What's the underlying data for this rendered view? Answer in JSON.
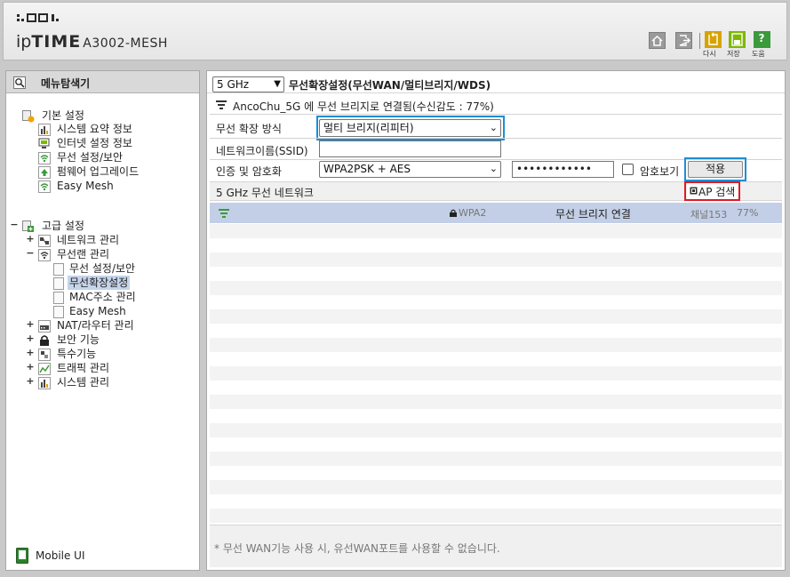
{
  "header": {
    "logo_dots": "▪▫▫▪",
    "brand": "ipTIME",
    "model": "A3002-MESH",
    "icons": [
      "home-icon",
      "logout-icon"
    ],
    "actions": [
      {
        "label": "다시",
        "icon": "refresh-icon",
        "color": "#d6a400"
      },
      {
        "label": "저장",
        "icon": "save-icon",
        "color": "#7fb800"
      },
      {
        "label": "도움",
        "icon": "help-icon",
        "color": "#3b9a3b"
      }
    ]
  },
  "sidebar": {
    "title": "메뉴탐색기",
    "basic": {
      "label": "기본 설정",
      "items": [
        "시스템 요약 정보",
        "인터넷 설정 정보",
        "무선 설정/보안",
        "펌웨어 업그레이드",
        "Easy Mesh"
      ]
    },
    "advanced": {
      "label": "고급 설정",
      "expander": "−",
      "items": [
        {
          "label": "네트워크 관리",
          "expander": "+"
        },
        {
          "label": "무선랜 관리",
          "expander": "−"
        },
        {
          "label": "NAT/라우터 관리",
          "expander": "+"
        },
        {
          "label": "보안 기능",
          "expander": "+"
        },
        {
          "label": "특수기능",
          "expander": "+"
        },
        {
          "label": "트래픽 관리",
          "expander": "+"
        },
        {
          "label": "시스템 관리",
          "expander": "+"
        }
      ],
      "wireless_sub": [
        "무선 설정/보안",
        "무선확장설정",
        "MAC주소 관리",
        "Easy Mesh"
      ],
      "selected": "무선확장설정"
    },
    "footer": "Mobile UI"
  },
  "main": {
    "band_select": "5 GHz",
    "page_title": "무선확장설정(무선WAN/멀티브리지/WDS)",
    "status": "AncoChu_5G 에 무선 브리지로 연결됨(수신감도 : 77%)",
    "form": {
      "mode_label": "무선 확장 방식",
      "mode_value": "멀티 브리지(리피터)",
      "ssid_label": "네트워크이름(SSID)",
      "ssid_value": "",
      "auth_label": "인증 및 암호화",
      "auth_value": "WPA2PSK + AES",
      "password_value": "••••••••••••",
      "show_password_label": "암호보기",
      "apply_button": "적용"
    },
    "network_section_title": "5 GHz 무선 네트워크",
    "ap_scan_button": "AP 검색",
    "ap_list": [
      {
        "security": "WPA2",
        "status": "무선 브리지 연결",
        "channel": "채널153",
        "signal": "77%"
      }
    ],
    "footnote": "* 무선 WAN기능 사용 시, 유선WAN포트를 사용할 수 없습니다."
  }
}
